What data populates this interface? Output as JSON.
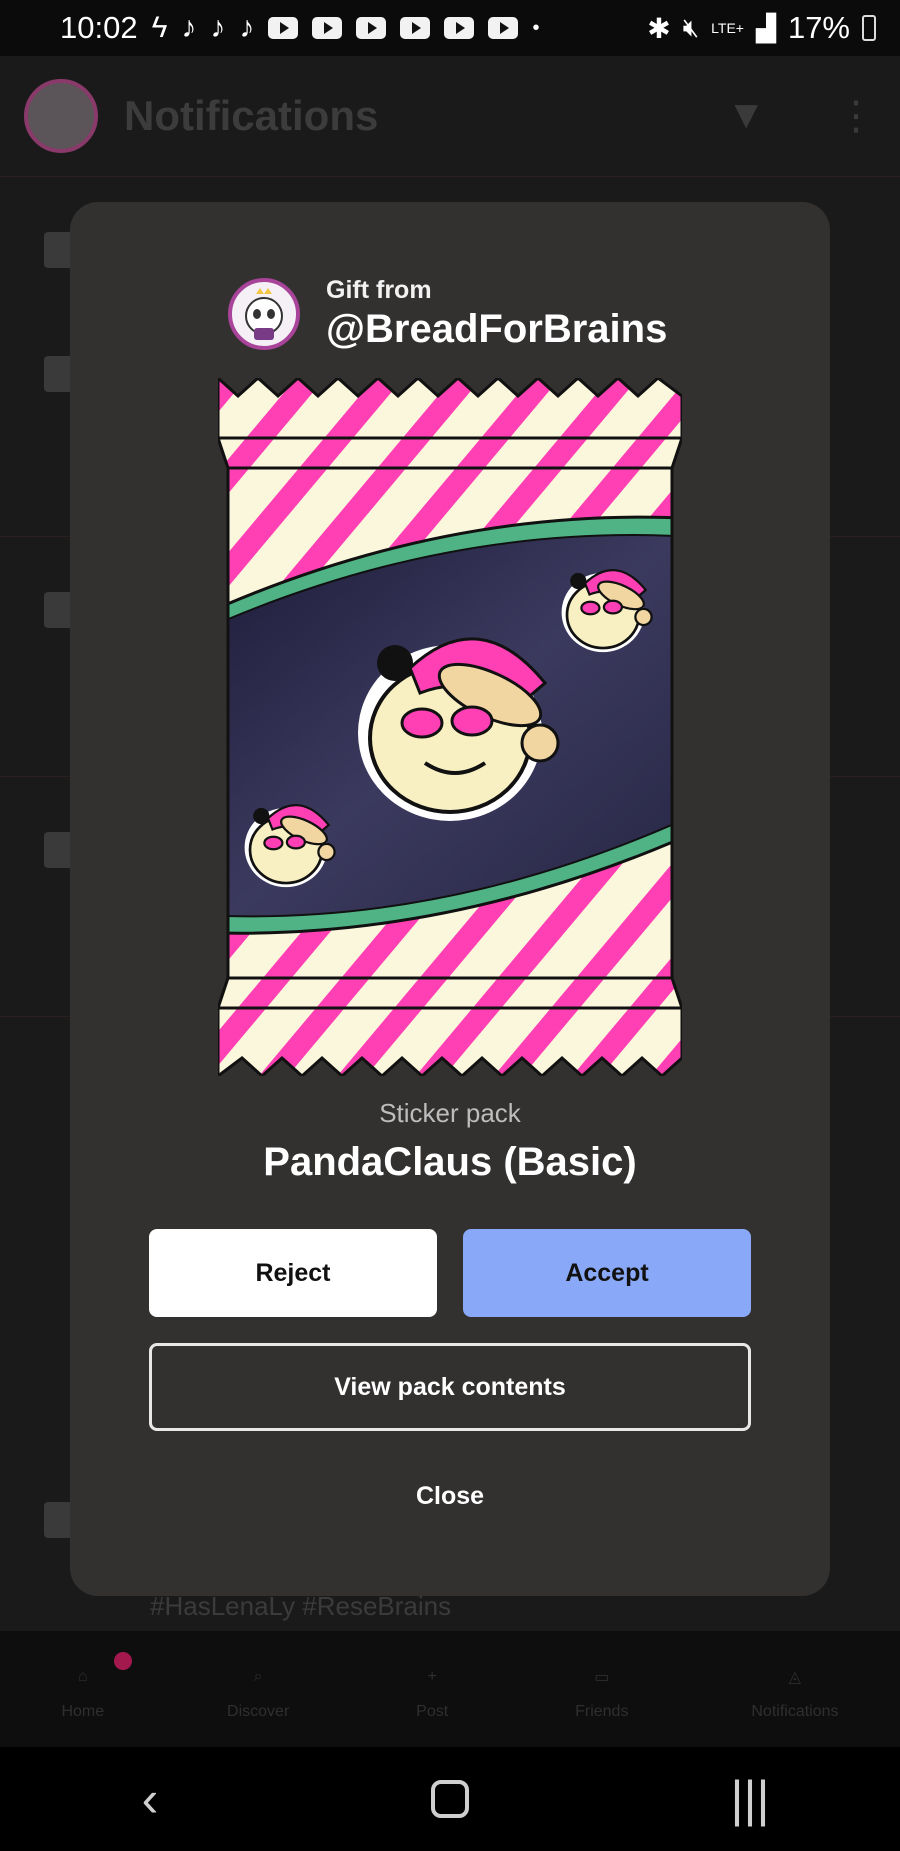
{
  "status_bar": {
    "time": "10:02",
    "battery": "17%",
    "network": "LTE+"
  },
  "background": {
    "title": "Notifications",
    "bottom_text": "#HasLenaLy #ReseBrains"
  },
  "bottom_nav": {
    "items": [
      {
        "label": "Home",
        "icon": "home-icon"
      },
      {
        "label": "Discover",
        "icon": "search-icon"
      },
      {
        "label": "Post",
        "icon": "plus-icon"
      },
      {
        "label": "Friends",
        "icon": "chat-icon"
      },
      {
        "label": "Notifications",
        "icon": "bell-icon"
      }
    ]
  },
  "modal": {
    "gift_from_label": "Gift from",
    "sender": "@BreadForBrains",
    "pack_type": "Sticker pack",
    "pack_name": "PandaClaus (Basic)",
    "reject_label": "Reject",
    "accept_label": "Accept",
    "view_label": "View pack contents",
    "close_label": "Close"
  },
  "colors": {
    "modal_bg": "#333130",
    "accept": "#8aa8f8",
    "stripe_pink": "#ff3fb4",
    "stripe_cream": "#fbf7dc",
    "band_green": "#4fb386"
  }
}
